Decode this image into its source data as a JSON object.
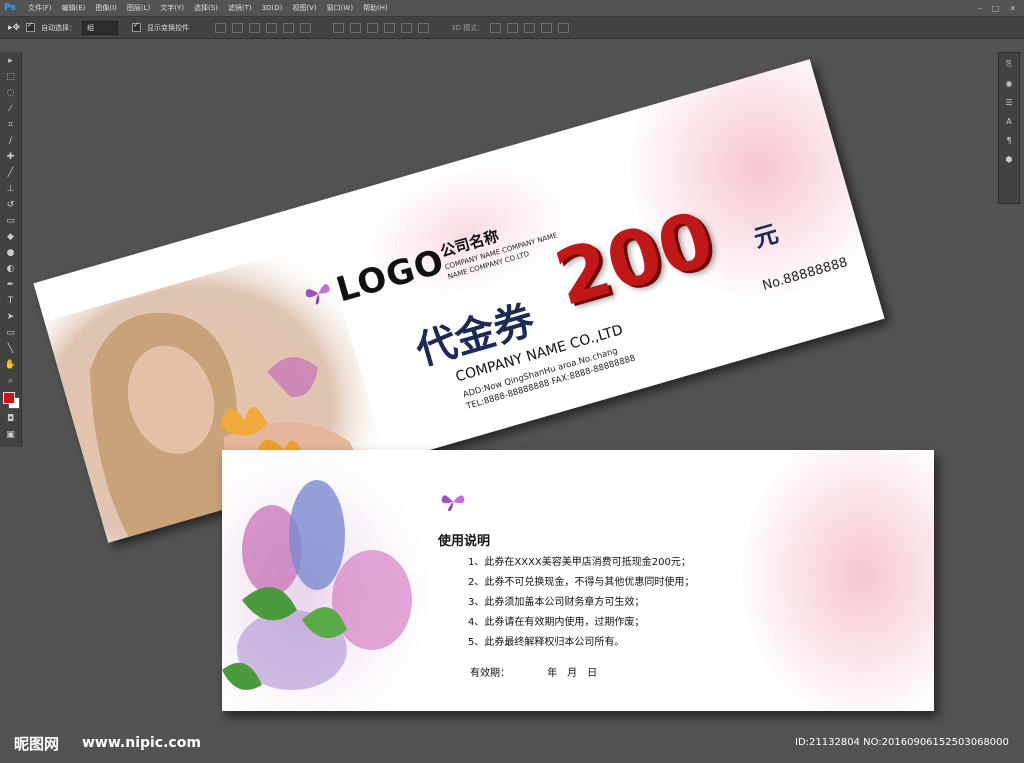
{
  "app": {
    "logo": "Ps"
  },
  "menu": [
    "文件(F)",
    "编辑(E)",
    "图像(I)",
    "图层(L)",
    "文字(Y)",
    "选择(S)",
    "滤镜(T)",
    "3D(D)",
    "视图(V)",
    "窗口(W)",
    "帮助(H)"
  ],
  "window_controls": [
    "–",
    "□",
    "✕"
  ],
  "options": {
    "auto_select_label": "自动选择：",
    "auto_select_value": "组",
    "show_transform_label": "显示变换控件",
    "mode_3d_label": "3D 模式："
  },
  "colors": {
    "foreground": "#c8141e",
    "background": "#ffffff",
    "amount": "#c01818",
    "navy": "#1e2a52"
  },
  "voucher_front": {
    "logo": "LOGO",
    "company_cn": "公司名称",
    "company_en_line1": "COMPANY NAME COMPANY NAME",
    "company_en_line2": "NAME COMPANY CO.LTD",
    "title": "代金券",
    "amount": "200",
    "unit": "元",
    "serial": "No.88888888",
    "company_name": "COMPANY NAME CO.,LTD",
    "address": "ADD:Now QingShanHu aroa.No.chang",
    "tel_fax": "TEL:8888-88888888   FAX:8888-88888888"
  },
  "voucher_back": {
    "title": "使用说明",
    "rules": [
      "1、此券在XXXX美容美甲店消费可抵现金200元；",
      "2、此券不可兑换现金，不得与其他优惠同时使用；",
      "3、此券须加盖本公司财务章方可生效；",
      "4、此券请在有效期内使用，过期作废；",
      "5、此券最终解释权归本公司所有。"
    ],
    "validity_label": "有效期：",
    "validity_units": "年　月　日"
  },
  "watermark": {
    "site_cn": "昵图网",
    "site_url": "www.nipic.com",
    "id_text": "ID:21132804 NO:20160906152503068000"
  }
}
